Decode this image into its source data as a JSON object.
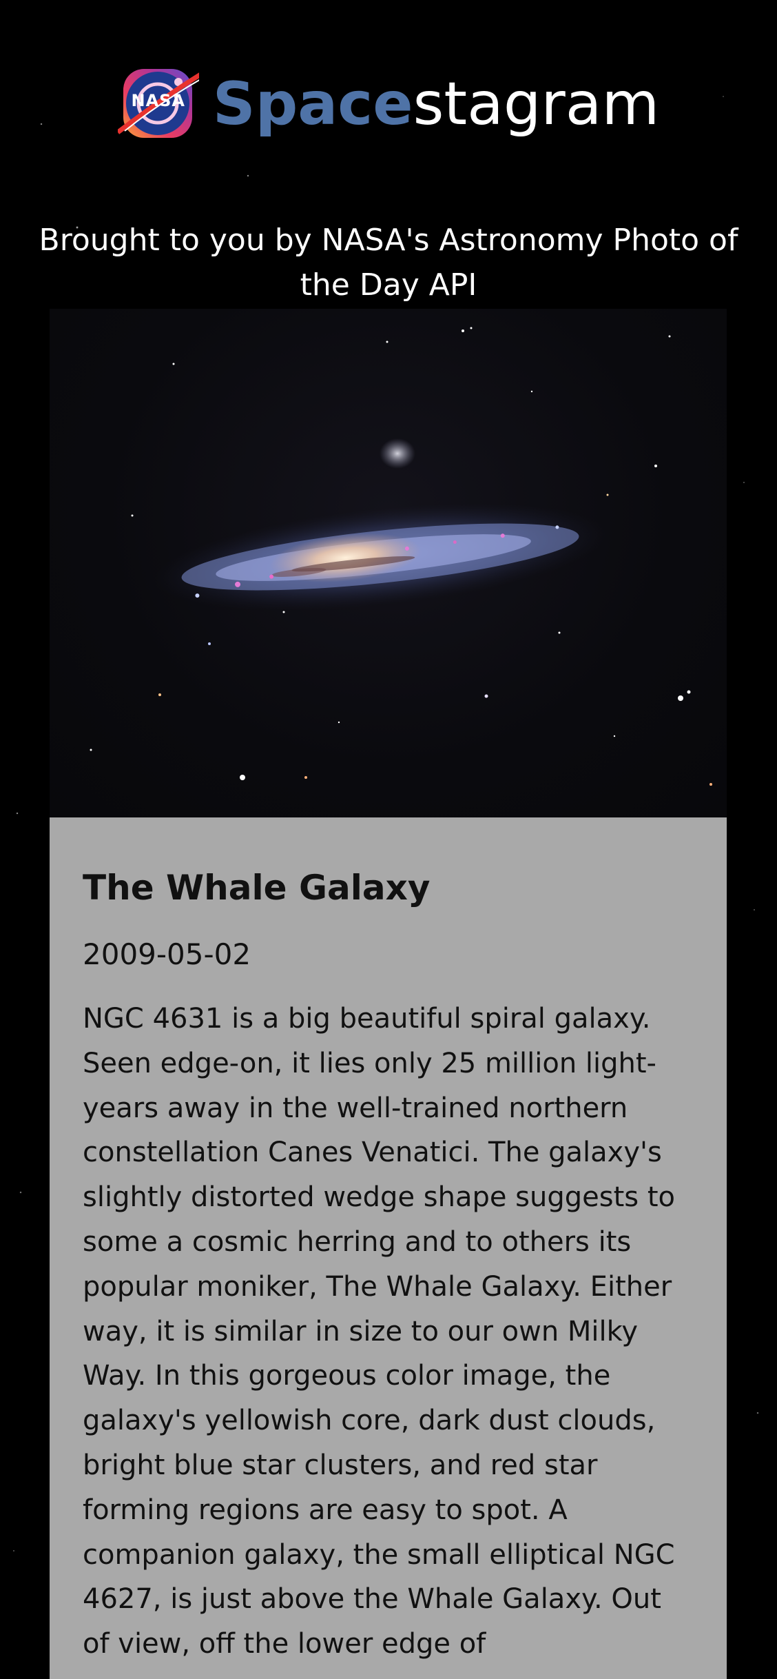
{
  "header": {
    "logo_text": "NASA",
    "title_part1": "Space",
    "title_part2": "stagram",
    "subtitle": "Brought to you by NASA's Astronomy Photo of the Day API"
  },
  "post": {
    "title": "The Whale Galaxy",
    "date": "2009-05-02",
    "description": "NGC 4631 is a big beautiful spiral galaxy. Seen edge-on, it lies only 25 million light-years away in the well-trained northern constellation Canes Venatici. The galaxy's slightly distorted wedge shape suggests to some a cosmic herring and to others its popular moniker, The Whale Galaxy. Either way, it is similar in size to our own Milky Way. In this gorgeous color image, the galaxy's yellowish core, dark dust clouds, bright blue star clusters, and red star forming regions are easy to spot. A companion galaxy, the small elliptical NGC 4627, is just above the Whale Galaxy. Out of view, off the lower edge of"
  },
  "colors": {
    "background": "#000000",
    "brand_accent": "#4f73a7",
    "card_background": "#a9a9a9",
    "text_light": "#ffffff",
    "text_dark": "#111111"
  },
  "icons": {
    "logo": "nasa-instagram-logo-icon"
  }
}
